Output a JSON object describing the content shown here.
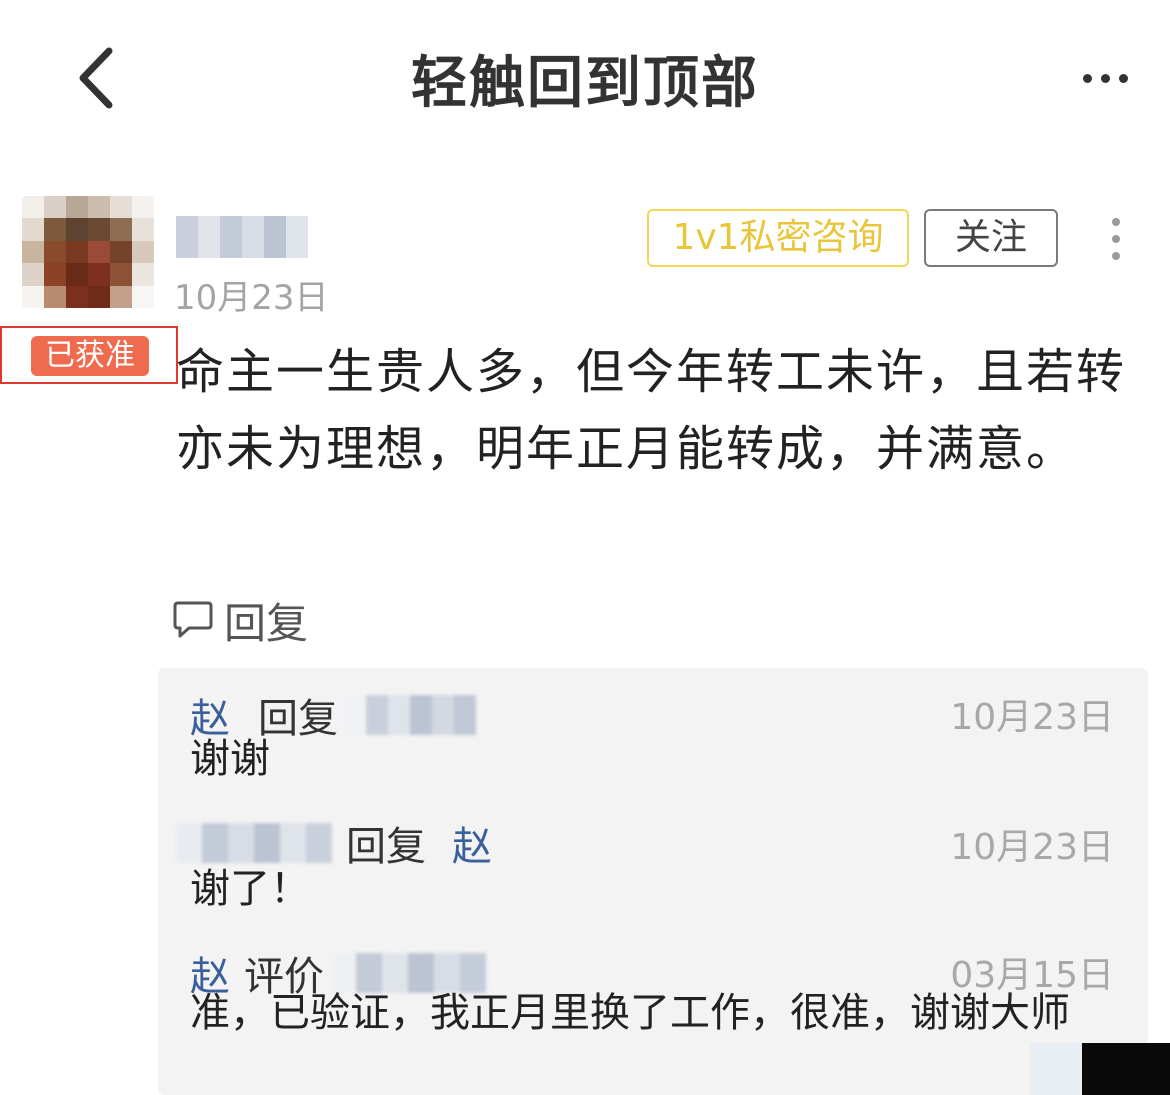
{
  "header": {
    "back_icon": "chevron-left-icon",
    "title": "轻触回到顶部",
    "more_icon": "more-horizontal-icon"
  },
  "post": {
    "badge": "已获准",
    "date": "10月23日",
    "consult_button": "1v1私密咨询",
    "follow_button": "关注",
    "more_icon": "more-vertical-icon",
    "content": "命主一生贵人多，但今年转工未许，且若转亦未为理想，明年正月能转成，并满意。",
    "reply_label": "回复",
    "reply_icon": "comment-icon",
    "colors": {
      "badge_bg": "#ef6b4f",
      "consult_border": "#f2d65a",
      "consult_text": "#e8c53a",
      "highlight_frame": "#e03a2f"
    }
  },
  "replies": [
    {
      "from": "赵",
      "verb": "回复",
      "date": "10月23日",
      "text": "谢谢"
    },
    {
      "verb": "回复",
      "to": "赵",
      "date": "10月23日",
      "text": "谢了！"
    },
    {
      "from": "赵",
      "verb": "评价",
      "date": "03月15日",
      "text": "准，已验证，我正月里换了工作，很准，谢谢大师"
    }
  ],
  "colors": {
    "name_link": "#3a5f9a"
  }
}
